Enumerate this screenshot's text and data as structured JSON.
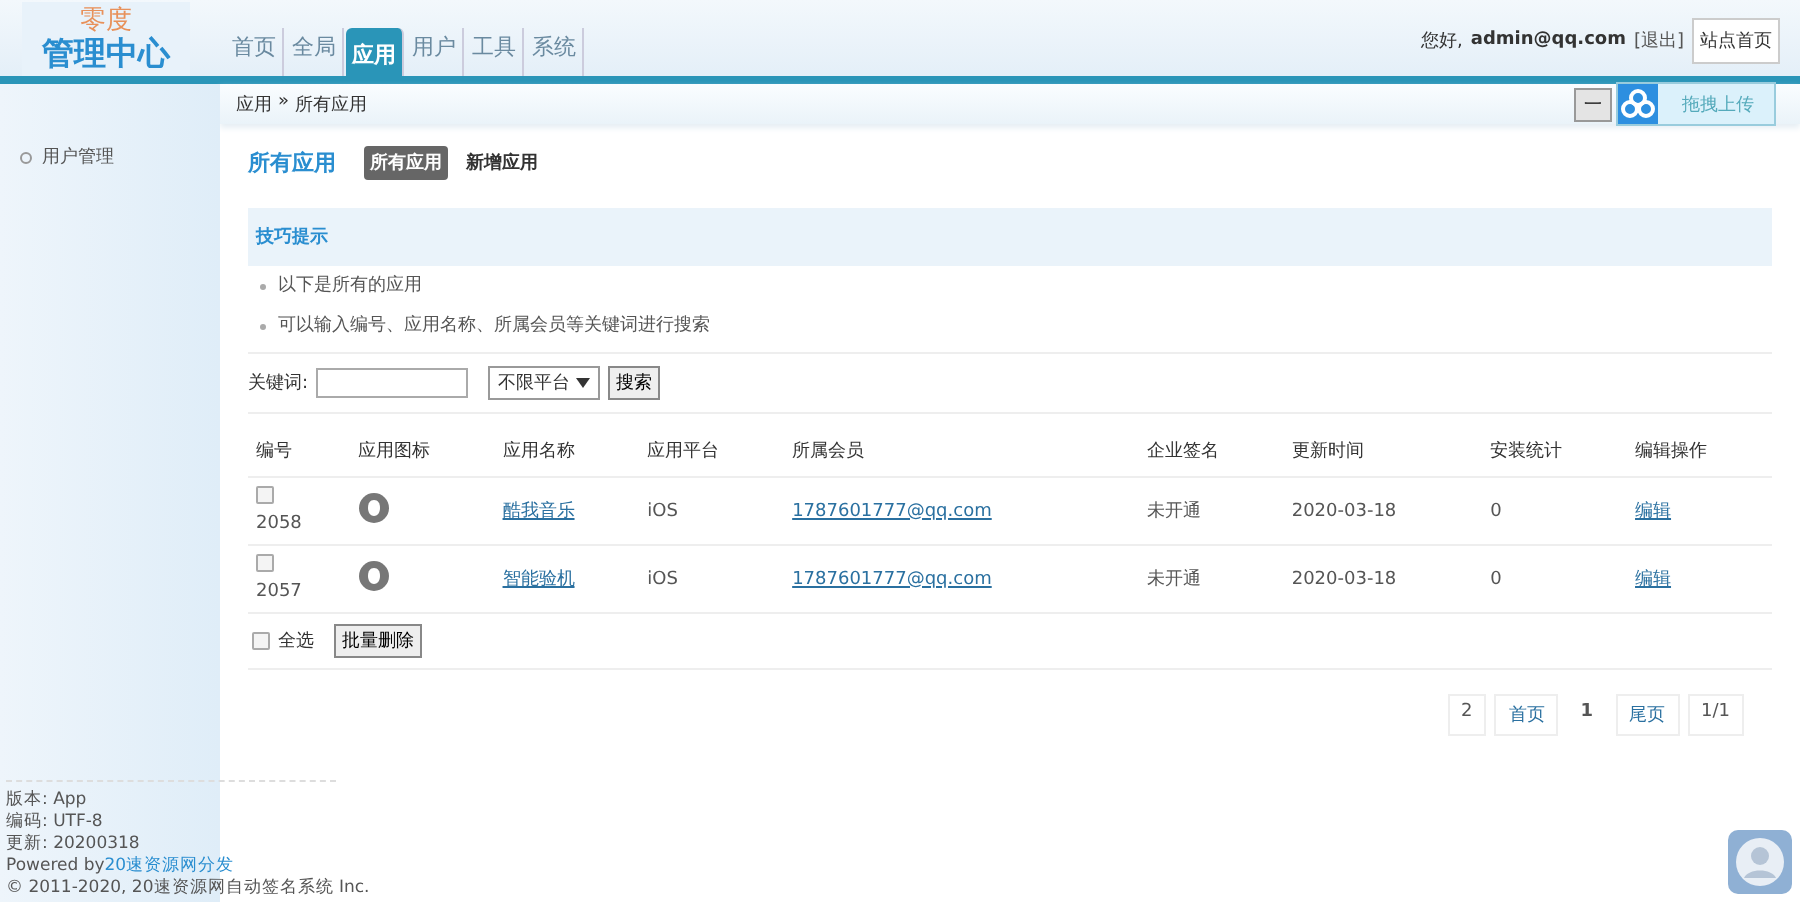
{
  "logo": {
    "top": "零度",
    "bottom": "管理中心"
  },
  "nav": [
    {
      "label": "首页",
      "selected": false
    },
    {
      "label": "全局",
      "selected": false
    },
    {
      "label": "应用",
      "selected": true
    },
    {
      "label": "用户",
      "selected": false
    },
    {
      "label": "工具",
      "selected": false
    },
    {
      "label": "系统",
      "selected": false
    }
  ],
  "user": {
    "greeting": "您好,",
    "account": "admin@qq.com",
    "logout": "[退出]",
    "home_button": "站点首页"
  },
  "breadcrumb": {
    "items": [
      "应用",
      "»",
      "所有应用"
    ],
    "action_button": "一",
    "upload_widget": "拖拽上传"
  },
  "sidebar": {
    "items": [
      {
        "label": "用户管理"
      }
    ],
    "footer": [
      "版本: App",
      "编码: UTF-8",
      "更新: 20200318"
    ],
    "powered": {
      "prefix": "Powered by",
      "link": "20速资源网分发"
    },
    "copyright": "© 2011-2020, 20速资源网自动签名系统 Inc."
  },
  "page": {
    "title": "所有应用",
    "tabs": [
      {
        "label": "所有应用",
        "selected": true
      },
      {
        "label": "新增应用",
        "selected": false
      }
    ]
  },
  "tips": {
    "title": "技巧提示",
    "items": [
      "以下是所有的应用",
      "可以输入编号、应用名称、所属会员等关键词进行搜索"
    ]
  },
  "search": {
    "label": "关键词:",
    "platform": "不限平台",
    "button": "搜索"
  },
  "table": {
    "columns": [
      "编号",
      "应用图标",
      "应用名称",
      "应用平台",
      "所属会员",
      "企业签名",
      "更新时间",
      "安装统计",
      "编辑操作"
    ],
    "rows": [
      {
        "checked": false,
        "id": "2058",
        "name": "酷我音乐",
        "platform": "iOS",
        "member": "1787601777@qq.com",
        "signing": "未开通",
        "time": "2020-03-18",
        "installs": "0",
        "action": "编辑"
      },
      {
        "checked": false,
        "id": "2057",
        "name": "智能验机",
        "platform": "iOS",
        "member": "1787601777@qq.com",
        "signing": "未开通",
        "time": "2020-03-18",
        "installs": "0",
        "action": "编辑"
      }
    ]
  },
  "bulk": {
    "select_all": "全选",
    "checked": false,
    "delete_button": "批量删除"
  },
  "pagination": [
    {
      "label": "2",
      "kind": "count"
    },
    {
      "label": "首页",
      "kind": "link"
    },
    {
      "label": "1",
      "kind": "current"
    },
    {
      "label": "尾页",
      "kind": "link"
    },
    {
      "label": "1/1",
      "kind": "count"
    }
  ]
}
